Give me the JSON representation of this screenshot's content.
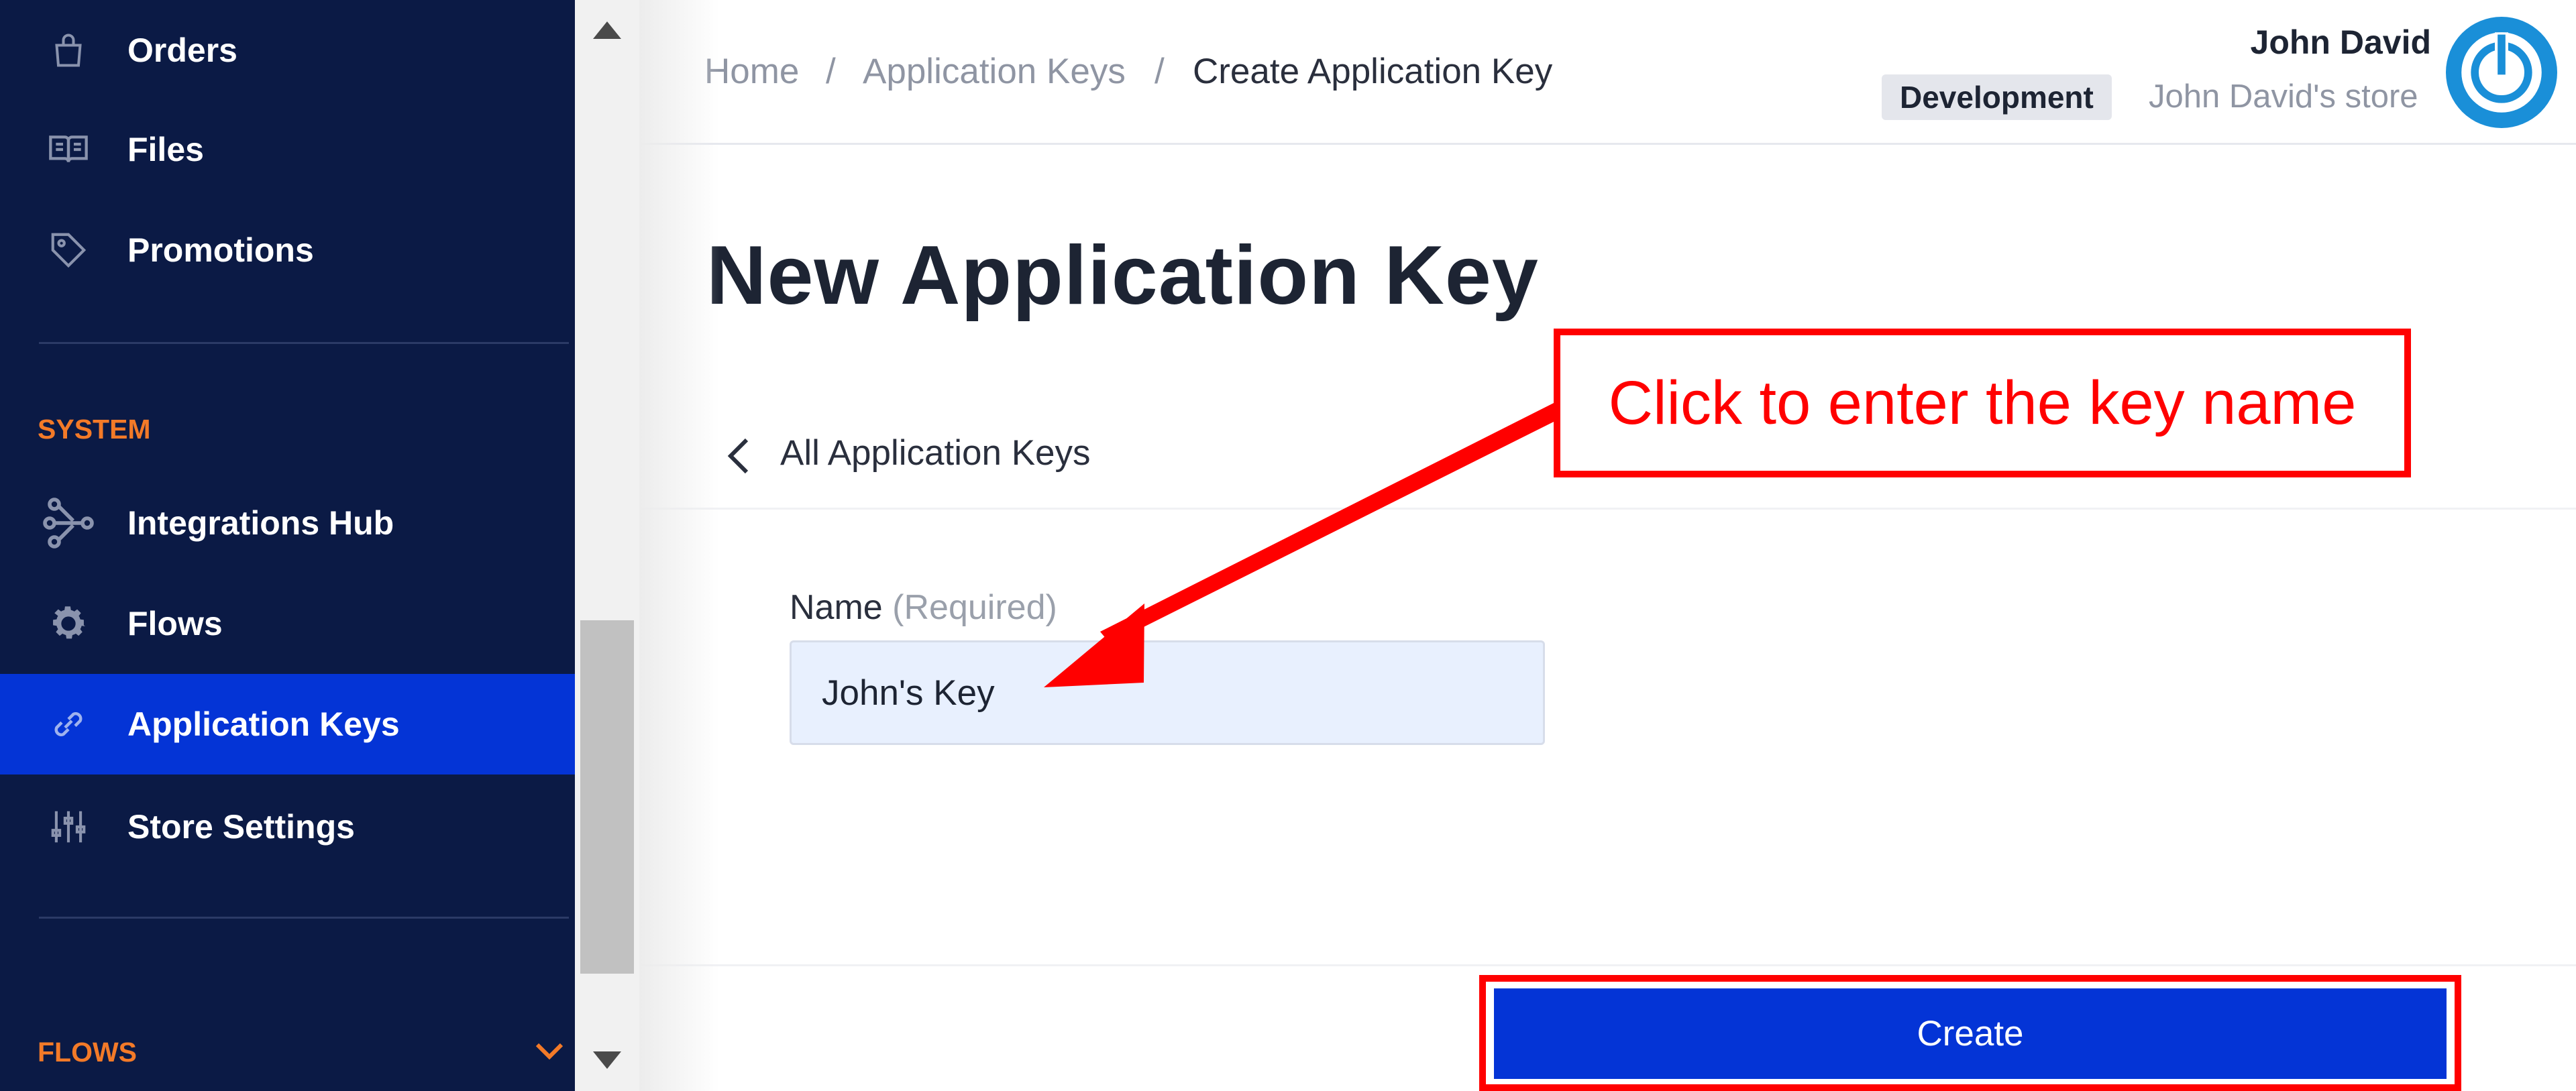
{
  "sidebar": {
    "items": [
      {
        "label": "Orders",
        "icon": "shopping-bag-icon"
      },
      {
        "label": "Files",
        "icon": "book-icon"
      },
      {
        "label": "Promotions",
        "icon": "tag-icon"
      },
      {
        "label": "Integrations Hub",
        "icon": "hub-icon"
      },
      {
        "label": "Flows",
        "icon": "gear-icon"
      },
      {
        "label": "Application Keys",
        "icon": "key-link-icon",
        "active": true
      },
      {
        "label": "Store Settings",
        "icon": "sliders-icon"
      }
    ],
    "sections": {
      "system": "SYSTEM",
      "flows": "FLOWS"
    },
    "accent_color": "#f37a28",
    "active_color": "#0434d6",
    "background_color": "#0b1a45"
  },
  "breadcrumb": [
    "Home",
    "Application Keys",
    "Create Application Key"
  ],
  "breadcrumb_separator": "/",
  "user": {
    "name": "John David",
    "environment": "Development",
    "store": "John David's store"
  },
  "page": {
    "title": "New Application Key",
    "back_label": "All Application Keys"
  },
  "form": {
    "name_label": "Name",
    "name_required": "(Required)",
    "name_value": "John's Key"
  },
  "create_label": "Create",
  "annotation": {
    "callout": "Click to enter the key name",
    "color": "#ff0000"
  }
}
